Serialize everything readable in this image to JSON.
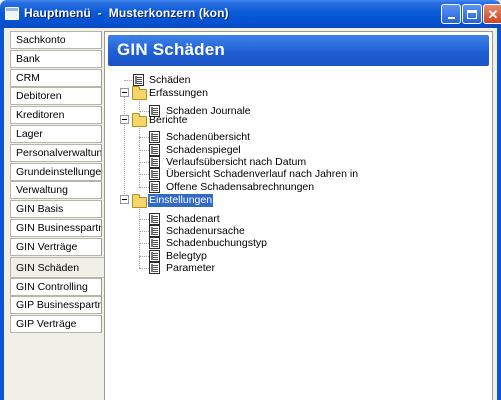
{
  "window": {
    "title": "Hauptmenü  -  Musterkonzern (kon)",
    "controls": {
      "close_label": "✕"
    }
  },
  "nav": {
    "items": [
      {
        "label": "Sachkonto"
      },
      {
        "label": "Bank"
      },
      {
        "label": "CRM"
      },
      {
        "label": "Debitoren"
      },
      {
        "label": "Kreditoren"
      },
      {
        "label": "Lager"
      },
      {
        "label": "Personalverwaltung"
      },
      {
        "label": "Grundeinstellungen"
      },
      {
        "label": "Verwaltung"
      },
      {
        "label": "GIN Basis"
      },
      {
        "label": "GIN Businesspartner"
      },
      {
        "label": "GIN Verträge"
      },
      {
        "label": "GIN Schäden"
      },
      {
        "label": "GIN Controlling"
      },
      {
        "label": "GIP Businesspartner"
      },
      {
        "label": "GIP Verträge"
      }
    ],
    "active": "GIN Schäden"
  },
  "panel": {
    "title": "GIN Schäden"
  },
  "tree": {
    "schaeden": "Schäden",
    "erfassungen": {
      "label": "Erfassungen",
      "children": [
        "Schaden Journale"
      ]
    },
    "berichte": {
      "label": "Berichte",
      "children": [
        "Schadenübersicht",
        "Schadenspiegel",
        "Verlaufsübersicht nach Datum",
        "Übersicht Schadenverlauf nach Jahren in",
        "Offene Schadensabrechnungen"
      ]
    },
    "einstellungen": {
      "label": "Einstellungen",
      "children": [
        "Schadenart",
        "Schadenursache",
        "Schadenbuchungstyp",
        "Belegtyp",
        "Parameter"
      ]
    },
    "selected": "Einstellungen"
  },
  "colors": {
    "titlebar": "#0a5ad8",
    "panel_header": "#1f5fd4",
    "selection": "#316ac5",
    "window_bg": "#f1f0e8"
  }
}
